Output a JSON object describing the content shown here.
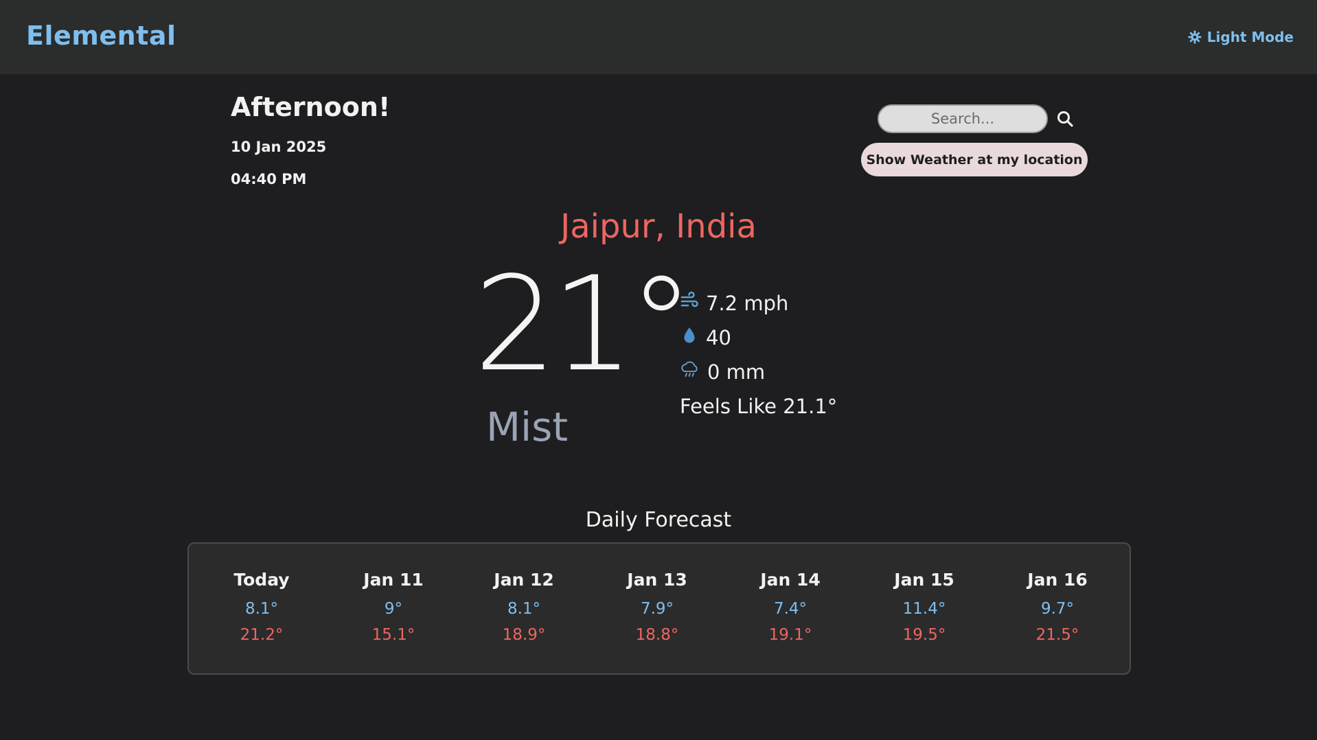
{
  "header": {
    "brand": "Elemental",
    "theme_toggle_label": "Light Mode",
    "theme_icon": "sun-gear-icon",
    "brand_color": "#7fbfee"
  },
  "greeting": {
    "title": "Afternoon!",
    "date": "10 Jan 2025",
    "time": "04:40 PM"
  },
  "search": {
    "placeholder": "Search...",
    "value": "",
    "icon": "search-icon",
    "location_button_label": "Show Weather at my location"
  },
  "current": {
    "city": "Jaipur, India",
    "temperature": "21°",
    "condition": "Mist",
    "wind": "7.2 mph",
    "humidity": "40",
    "precipitation": "0 mm",
    "feels_like": "Feels Like 21.1°",
    "wind_icon": "wind-icon",
    "humidity_icon": "droplet-icon",
    "precip_icon": "rain-cloud-icon"
  },
  "forecast": {
    "title": "Daily Forecast",
    "days": [
      {
        "label": "Today",
        "min": "8.1°",
        "max": "21.2°"
      },
      {
        "label": "Jan 11",
        "min": "9°",
        "max": "15.1°"
      },
      {
        "label": "Jan 12",
        "min": "8.1°",
        "max": "18.9°"
      },
      {
        "label": "Jan 13",
        "min": "7.9°",
        "max": "18.8°"
      },
      {
        "label": "Jan 14",
        "min": "7.4°",
        "max": "19.1°"
      },
      {
        "label": "Jan 15",
        "min": "11.4°",
        "max": "19.5°"
      },
      {
        "label": "Jan 16",
        "min": "9.7°",
        "max": "21.5°"
      }
    ]
  },
  "colors": {
    "accent_blue": "#7fbfee",
    "accent_red": "#ee6660",
    "background": "#1e1e20",
    "header_bg": "#2b2c2c"
  }
}
